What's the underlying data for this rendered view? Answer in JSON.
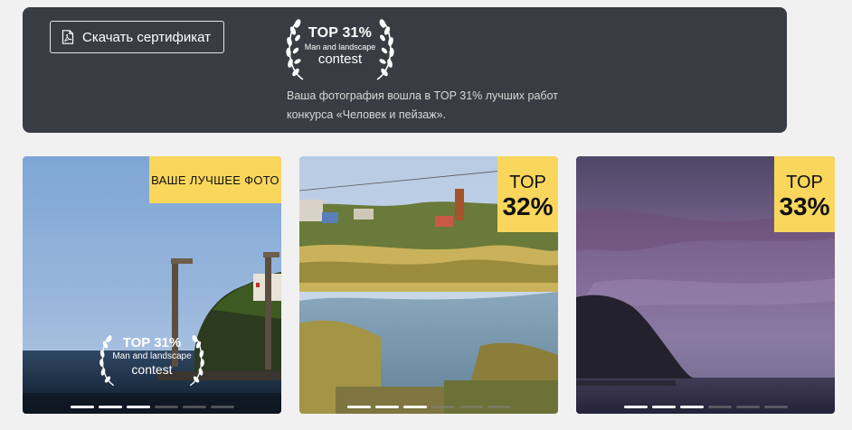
{
  "banner": {
    "download_label": "Скачать сертификат",
    "download_icon": "pdf-file-icon",
    "award": {
      "top": "TOP 31%",
      "subtitle": "Man and landscape",
      "contest": "contest"
    },
    "description": "Ваша фотография вошла в TOP 31% лучших работ конкурса «Человек и пейзаж»."
  },
  "photos": [
    {
      "badge_label": "ВАШЕ ЛУЧШЕЕ ФОТО",
      "overlay_award": {
        "top": "TOP 31%",
        "subtitle": "Man and landscape",
        "contest": "contest"
      },
      "dots_total": 6,
      "dots_active": 3
    },
    {
      "badge_top": "TOP",
      "badge_pct": "32%",
      "dots_total": 6,
      "dots_active": 3
    },
    {
      "badge_top": "TOP",
      "badge_pct": "33%",
      "dots_total": 6,
      "dots_active": 3
    }
  ],
  "colors": {
    "banner_bg": "#393c43",
    "page_bg": "#f1f1f1",
    "badge_bg": "#f9d65c"
  }
}
